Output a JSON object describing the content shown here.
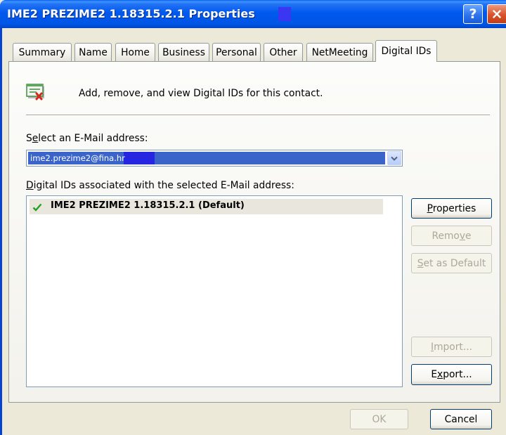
{
  "window": {
    "title": "IME2 PREZIME2 1.18315.2.1 Properties",
    "help_label": "?",
    "close_icon": "close-icon"
  },
  "tabs": [
    {
      "label": "Summary",
      "selected": false
    },
    {
      "label": "Name",
      "selected": false
    },
    {
      "label": "Home",
      "selected": false
    },
    {
      "label": "Business",
      "selected": false
    },
    {
      "label": "Personal",
      "selected": false
    },
    {
      "label": "Other",
      "selected": false
    },
    {
      "label": "NetMeeting",
      "selected": false
    },
    {
      "label": "Digital IDs",
      "selected": true
    }
  ],
  "digital_ids_page": {
    "header_icon": "digital-id-icon",
    "description": "Add, remove, and view Digital IDs for this contact.",
    "select_email_label": {
      "text": "Select an E-Mail address:",
      "access_key_index": 1
    },
    "email_select": {
      "value": "ime2.prezime2@fina.hr",
      "dropdown_icon": "chevron-down-icon"
    },
    "ids_list_label": {
      "text": "Digital IDs associated with the selected E-Mail address:",
      "access_key_index": 0
    },
    "ids_list": [
      {
        "name": "IME2 PREZIME2 1.18315.2.1 (Default)",
        "icon": "checkmark-icon",
        "selected": true
      }
    ],
    "buttons": {
      "properties": {
        "label": "Properties",
        "access_key_index": 0,
        "enabled": true
      },
      "remove": {
        "label": "Remove",
        "access_key_index": 4,
        "enabled": false
      },
      "set_as_default": {
        "label": "Set as Default",
        "access_key_index": 0,
        "enabled": false
      },
      "import": {
        "label": "Import...",
        "access_key_index": 0,
        "enabled": false
      },
      "export": {
        "label": "Export...",
        "access_key_index": 1,
        "enabled": true
      }
    }
  },
  "footer": {
    "ok": {
      "label": "OK",
      "enabled": false
    },
    "cancel": {
      "label": "Cancel",
      "enabled": true
    }
  },
  "colors": {
    "title_bar": "#0058EE",
    "window_body": "#ECE9D8",
    "selection": "#3A64C9",
    "check_mark": "#21A121",
    "button_border": "#003C74",
    "disabled_text": "#ACA899"
  }
}
